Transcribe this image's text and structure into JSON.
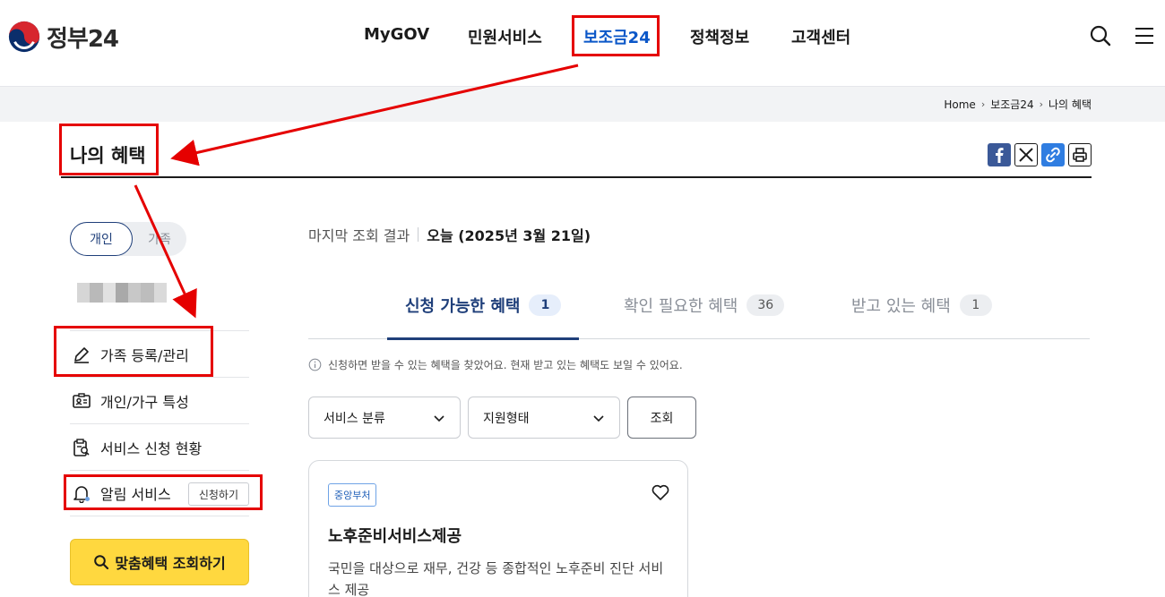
{
  "header": {
    "logo_text": "정부24",
    "nav": [
      {
        "label": "MyGOV"
      },
      {
        "label": "민원서비스"
      },
      {
        "label": "보조금24"
      },
      {
        "label": "정책정보"
      },
      {
        "label": "고객센터"
      }
    ],
    "active_color": "#0b57c8"
  },
  "breadcrumb": [
    "Home",
    "보조금24",
    "나의 혜택"
  ],
  "page": {
    "title": "나의 혜택"
  },
  "share": [
    "facebook-icon",
    "x-icon",
    "link-icon",
    "print-icon"
  ],
  "sidebar": {
    "toggle": {
      "selected": "개인",
      "other": "가족"
    },
    "menu": [
      {
        "label": "가족 등록/관리",
        "icon": "pencil-icon"
      },
      {
        "label": "개인/가구 특성",
        "icon": "id-card-icon"
      },
      {
        "label": "서비스 신청 현황",
        "icon": "clipboard-search-icon"
      },
      {
        "label": "알림 서비스",
        "icon": "bell-icon",
        "button": "신청하기"
      }
    ],
    "cta": "맞춤혜택 조회하기"
  },
  "main": {
    "last_view_label": "마지막 조회 결과",
    "last_view_value": "오늘 (2025년 3월 21일)",
    "tabs": [
      {
        "label": "신청 가능한 혜택",
        "count": "1"
      },
      {
        "label": "확인 필요한 혜택",
        "count": "36"
      },
      {
        "label": "받고 있는 혜택",
        "count": "1"
      }
    ],
    "info": "신청하면 받을 수 있는 혜택을 찾았어요. 현재 받고 있는 혜택도 보일 수 있어요.",
    "filters": {
      "category": "서비스 분류",
      "support_type": "지원형태",
      "search": "조회"
    },
    "card": {
      "badge": "중앙부처",
      "title": "노후준비서비스제공",
      "desc": "국민을 대상으로 재무, 건강 등 종합적인 노후준비 진단 서비스 제공"
    }
  },
  "colors": {
    "brand_navy": "#1f3f7a",
    "cta_yellow": "#ffd83f",
    "annotation_red": "#e50000"
  }
}
